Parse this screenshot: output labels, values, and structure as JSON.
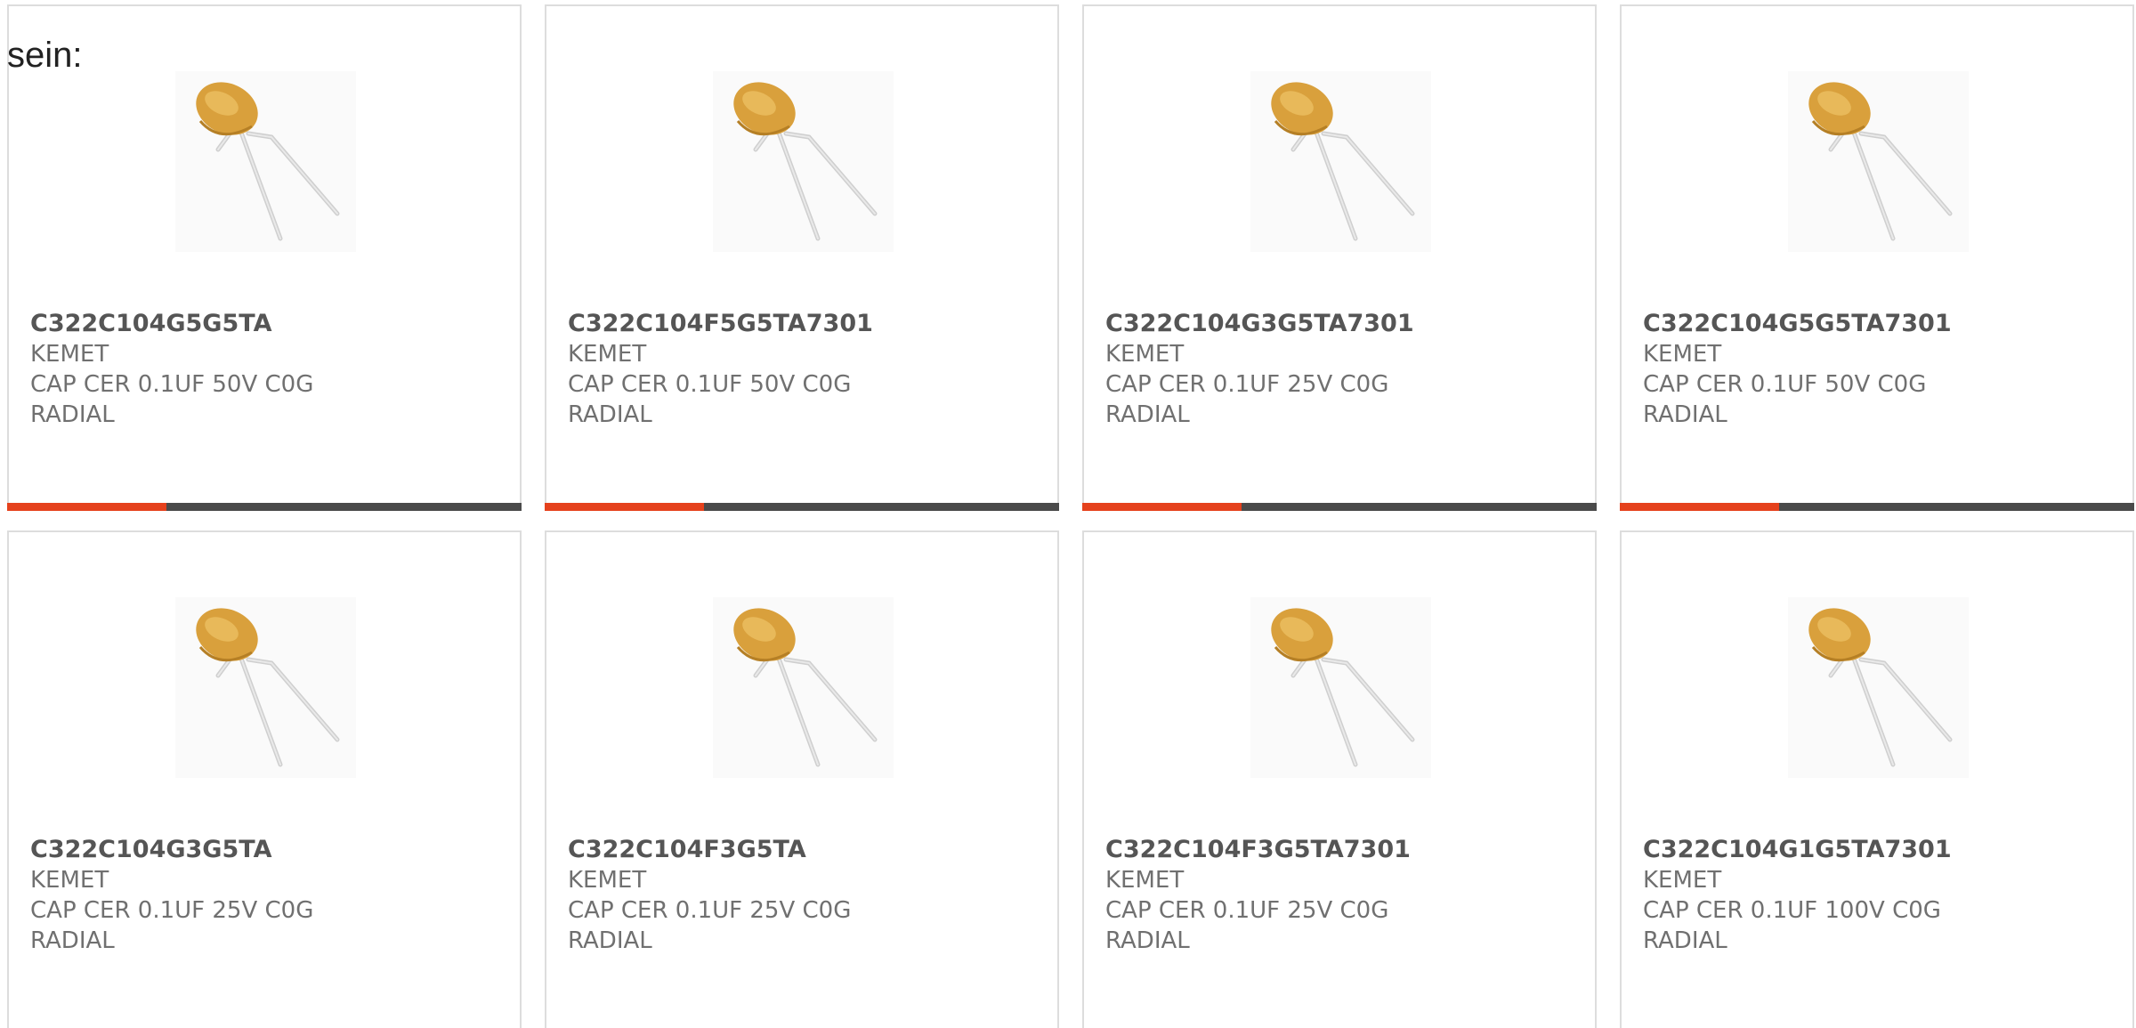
{
  "intro_text": "sein:",
  "colors": {
    "accent": "#e5411c",
    "track": "#4a4a4a",
    "border": "#dddddd",
    "capacitor_body": "#d9a03c",
    "lead": "#cfcfcf"
  },
  "products": [
    {
      "part_number": "C322C104G5G5TA",
      "manufacturer": "KEMET",
      "description": "CAP CER 0.1UF 50V C0G RADIAL",
      "image_icon": "ceramic-capacitor-icon",
      "progress": 0.31
    },
    {
      "part_number": "C322C104F5G5TA7301",
      "manufacturer": "KEMET",
      "description": "CAP CER 0.1UF 50V C0G RADIAL",
      "image_icon": "ceramic-capacitor-icon",
      "progress": 0.31
    },
    {
      "part_number": "C322C104G3G5TA7301",
      "manufacturer": "KEMET",
      "description": "CAP CER 0.1UF 25V C0G RADIAL",
      "image_icon": "ceramic-capacitor-icon",
      "progress": 0.31
    },
    {
      "part_number": "C322C104G5G5TA7301",
      "manufacturer": "KEMET",
      "description": "CAP CER 0.1UF 50V C0G RADIAL",
      "image_icon": "ceramic-capacitor-icon",
      "progress": 0.31
    },
    {
      "part_number": "C322C104G3G5TA",
      "manufacturer": "KEMET",
      "description": "CAP CER 0.1UF 25V C0G RADIAL",
      "image_icon": "ceramic-capacitor-icon"
    },
    {
      "part_number": "C322C104F3G5TA",
      "manufacturer": "KEMET",
      "description": "CAP CER 0.1UF 25V C0G RADIAL",
      "image_icon": "ceramic-capacitor-icon"
    },
    {
      "part_number": "C322C104F3G5TA7301",
      "manufacturer": "KEMET",
      "description": "CAP CER 0.1UF 25V C0G RADIAL",
      "image_icon": "ceramic-capacitor-icon"
    },
    {
      "part_number": "C322C104G1G5TA7301",
      "manufacturer": "KEMET",
      "description": "CAP CER 0.1UF 100V C0G RADIAL",
      "image_icon": "ceramic-capacitor-icon"
    }
  ]
}
